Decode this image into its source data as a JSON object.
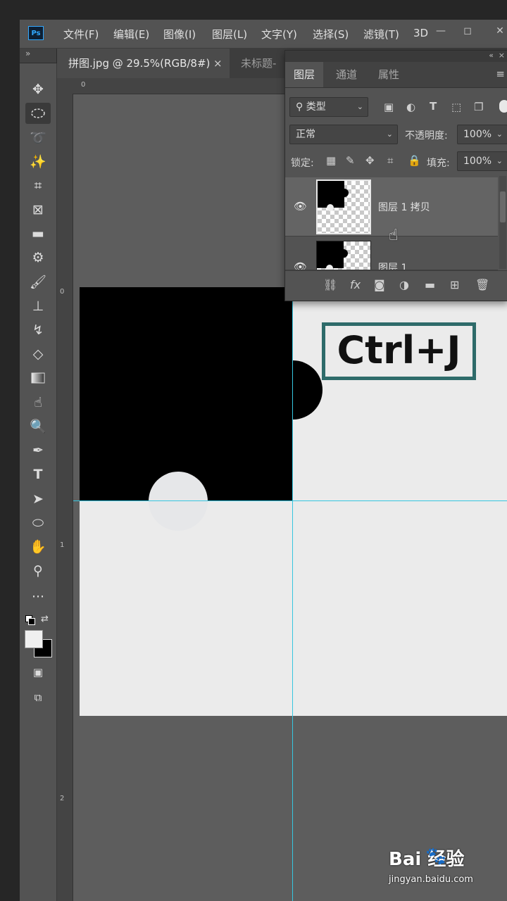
{
  "app": {
    "logo": "Ps",
    "menu": [
      "文件(F)",
      "编辑(E)",
      "图像(I)",
      "图层(L)",
      "文字(Y)",
      "选择(S)",
      "滤镜(T)",
      "3D"
    ]
  },
  "window_controls": {
    "minimize": "—",
    "restore": "◻",
    "close": "✕"
  },
  "tabs": [
    {
      "label": "拼图.jpg @ 29.5%(RGB/8#)",
      "close": "×"
    },
    {
      "label": "未标题-"
    }
  ],
  "rulers": {
    "top": [
      "0"
    ],
    "left": [
      "0",
      "1",
      "2"
    ]
  },
  "toolbar": {
    "collapse_label": "»",
    "tools": [
      "move-tool-icon",
      "elliptical-marquee-icon",
      "lasso-icon",
      "magic-wand-icon",
      "crop-icon",
      "frame-icon",
      "ruler-icon",
      "patch-icon",
      "brush-icon",
      "stamp-icon",
      "history-brush-icon",
      "eraser-icon",
      "gradient-icon",
      "smudge-icon",
      "dodge-icon",
      "pen-icon",
      "type-icon",
      "path-select-icon",
      "ellipse-shape-icon",
      "hand-icon",
      "zoom-icon",
      "more-tools-icon"
    ],
    "active_tool": "elliptical-marquee-icon",
    "foreground_color": "#f0f0f0",
    "background_color": "#000000"
  },
  "canvas": {
    "annotation": "Ctrl+J",
    "annotation_border_color": "#2e6b6a",
    "guide_color": "#36c6e0"
  },
  "layers_panel": {
    "tabs": [
      "图层",
      "通道",
      "属性"
    ],
    "active_tab": "图层",
    "filter_kind": "类型",
    "blend_mode": "正常",
    "opacity_label": "不透明度:",
    "opacity_value": "100%",
    "lock_label": "锁定:",
    "fill_label": "填充:",
    "fill_value": "100%",
    "layers": [
      {
        "name": "图层 1 拷贝",
        "visible": true,
        "selected": true
      },
      {
        "name": "图层 1",
        "visible": true,
        "selected": false
      }
    ]
  },
  "watermark": {
    "brand": "Bai  经验",
    "url": "jingyan.baidu.com"
  }
}
